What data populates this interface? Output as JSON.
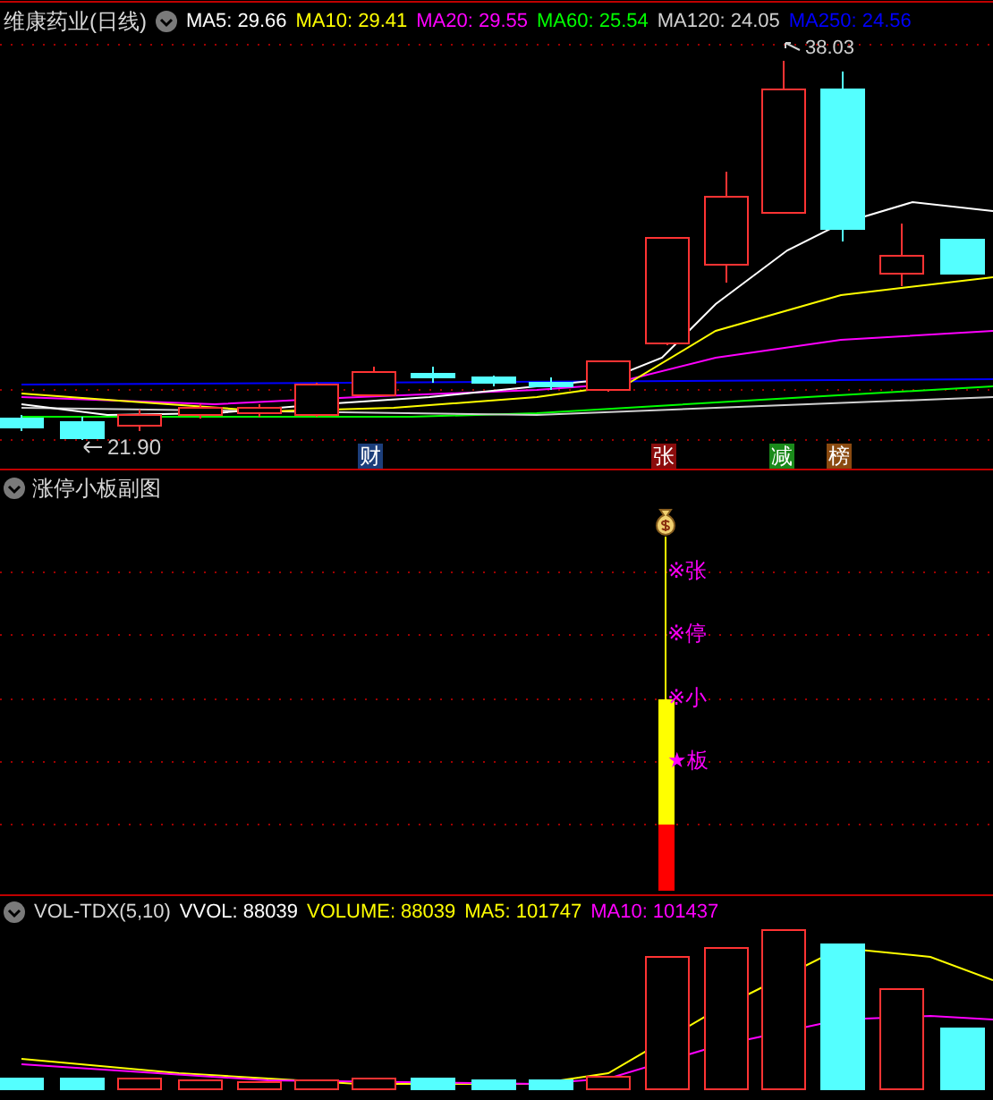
{
  "main": {
    "title": "维康药业(日线)",
    "indicators": [
      {
        "label": "MA5: 29.66",
        "color": "#ffffff"
      },
      {
        "label": "MA10: 29.41",
        "color": "#ffff00"
      },
      {
        "label": "MA20: 29.55",
        "color": "#ff00ff"
      },
      {
        "label": "MA60: 25.54",
        "color": "#00ff00"
      },
      {
        "label": "MA120: 24.05",
        "color": "#d0d0d0"
      },
      {
        "label": "MA250: 24.56",
        "color": "#0000ff"
      }
    ],
    "high_label": "38.03",
    "low_label": "21.90",
    "event_badges": [
      {
        "text": "财",
        "color": "#1c3e7a"
      },
      {
        "text": "张",
        "color": "#8a0c0c"
      },
      {
        "text": "减",
        "color": "#1a8a1a"
      },
      {
        "text": "榜",
        "color": "#8a4a10"
      }
    ]
  },
  "sub": {
    "title": "涨停小板副图",
    "markers": [
      {
        "text": "※张"
      },
      {
        "text": "※停"
      },
      {
        "text": "※小"
      },
      {
        "text": "★板"
      }
    ]
  },
  "volume": {
    "title": "VOL-TDX(5,10)",
    "indicators": [
      {
        "label": "VVOL: 88039",
        "color": "#ffffff"
      },
      {
        "label": "VOLUME: 88039",
        "color": "#ffff00"
      },
      {
        "label": "MA5: 101747",
        "color": "#ffff00"
      },
      {
        "label": "MA10: 101437",
        "color": "#ff00ff"
      }
    ]
  }
}
